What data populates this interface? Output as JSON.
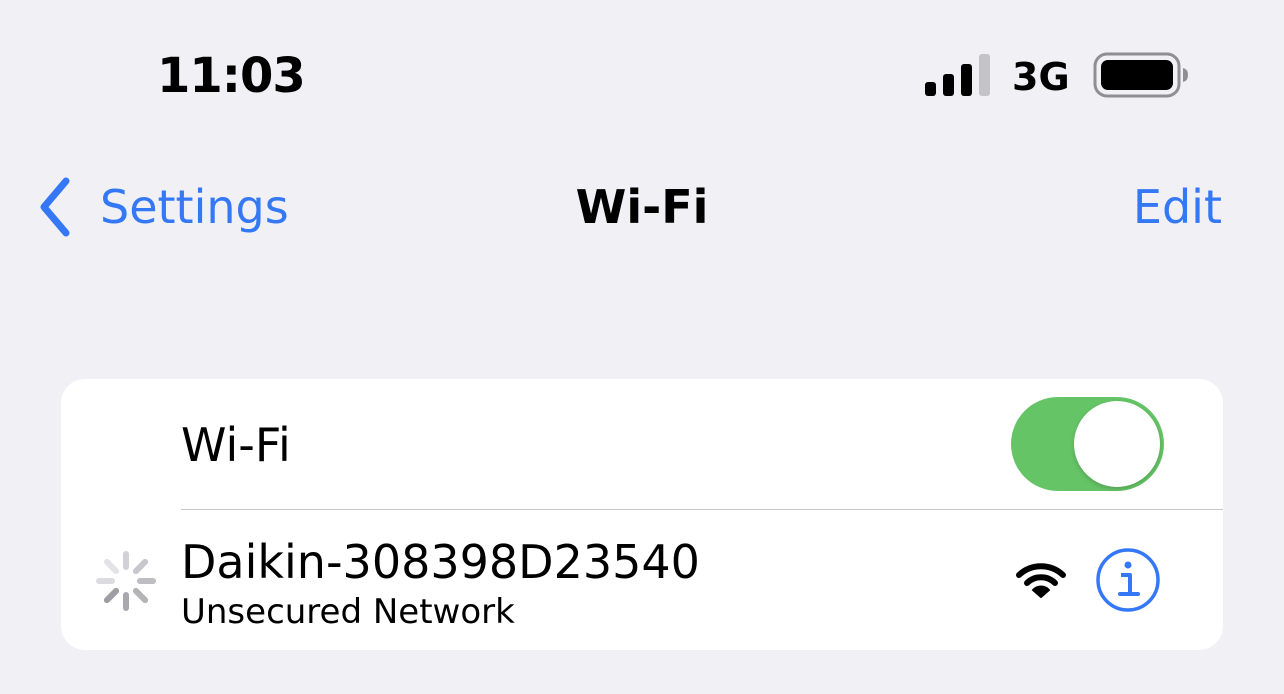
{
  "status_bar": {
    "time": "11:03",
    "network_type": "3G",
    "signal_icon": "cellular-signal-icon",
    "battery_icon": "battery-icon"
  },
  "nav": {
    "back_label": "Settings",
    "title": "Wi-Fi",
    "edit_label": "Edit"
  },
  "wifi_toggle": {
    "label": "Wi-Fi",
    "on": true
  },
  "networks": [
    {
      "name": "Daikin-308398D23540",
      "subtitle": "Unsecured Network",
      "connecting": true
    }
  ],
  "colors": {
    "accent": "#3478f6",
    "toggle_on": "#65c466",
    "background": "#f0f0f5"
  }
}
